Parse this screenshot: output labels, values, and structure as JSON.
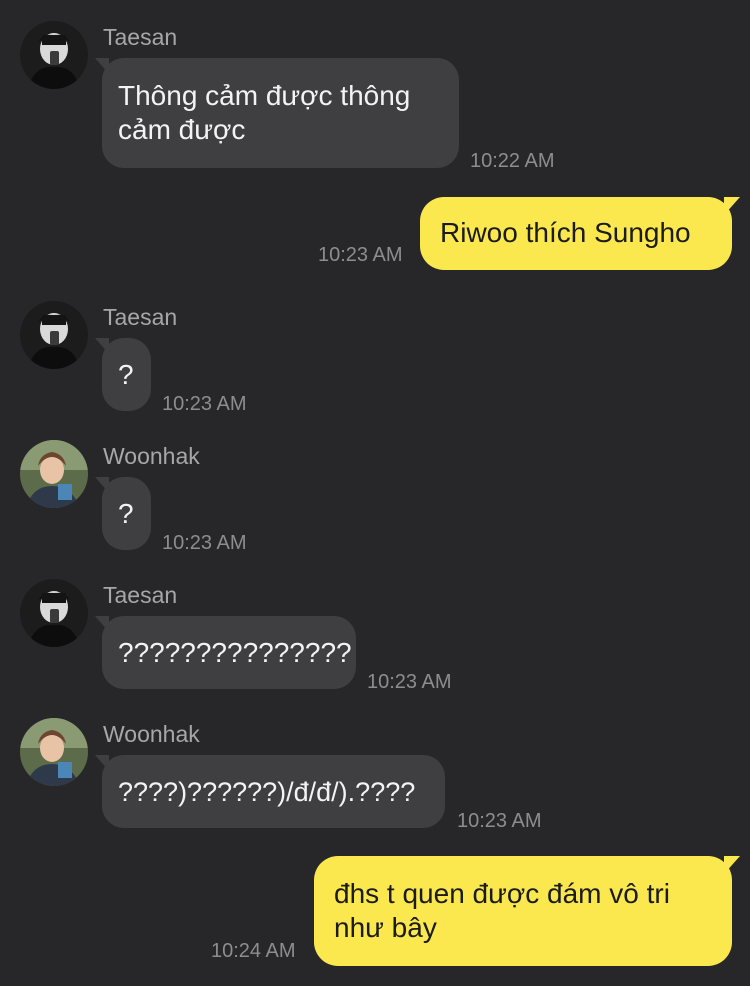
{
  "colors": {
    "background": "#272729",
    "incoming_bubble": "#3f3f42",
    "outgoing_bubble": "#fbe84e",
    "sender_name": "#a7a7ab",
    "timestamp": "#8d8d91"
  },
  "messages": [
    {
      "direction": "incoming",
      "sender": "Taesan",
      "avatar_icon": "taesan-avatar-icon",
      "text": "Thông cảm được thông cảm được",
      "time": "10:22 AM"
    },
    {
      "direction": "outgoing",
      "text": "Riwoo thích Sungho",
      "time": "10:23 AM"
    },
    {
      "direction": "incoming",
      "sender": "Taesan",
      "avatar_icon": "taesan-avatar-icon",
      "text": "?",
      "time": "10:23 AM"
    },
    {
      "direction": "incoming",
      "sender": "Woonhak",
      "avatar_icon": "woonhak-avatar-icon",
      "text": "?",
      "time": "10:23 AM"
    },
    {
      "direction": "incoming",
      "sender": "Taesan",
      "avatar_icon": "taesan-avatar-icon",
      "text": "???????????????",
      "time": "10:23 AM"
    },
    {
      "direction": "incoming",
      "sender": "Woonhak",
      "avatar_icon": "woonhak-avatar-icon",
      "text": "????)??????)/đ/đ/).????",
      "time": "10:23 AM"
    },
    {
      "direction": "outgoing",
      "text": "đhs t quen được đám vô tri như bây",
      "time": "10:24 AM"
    }
  ]
}
